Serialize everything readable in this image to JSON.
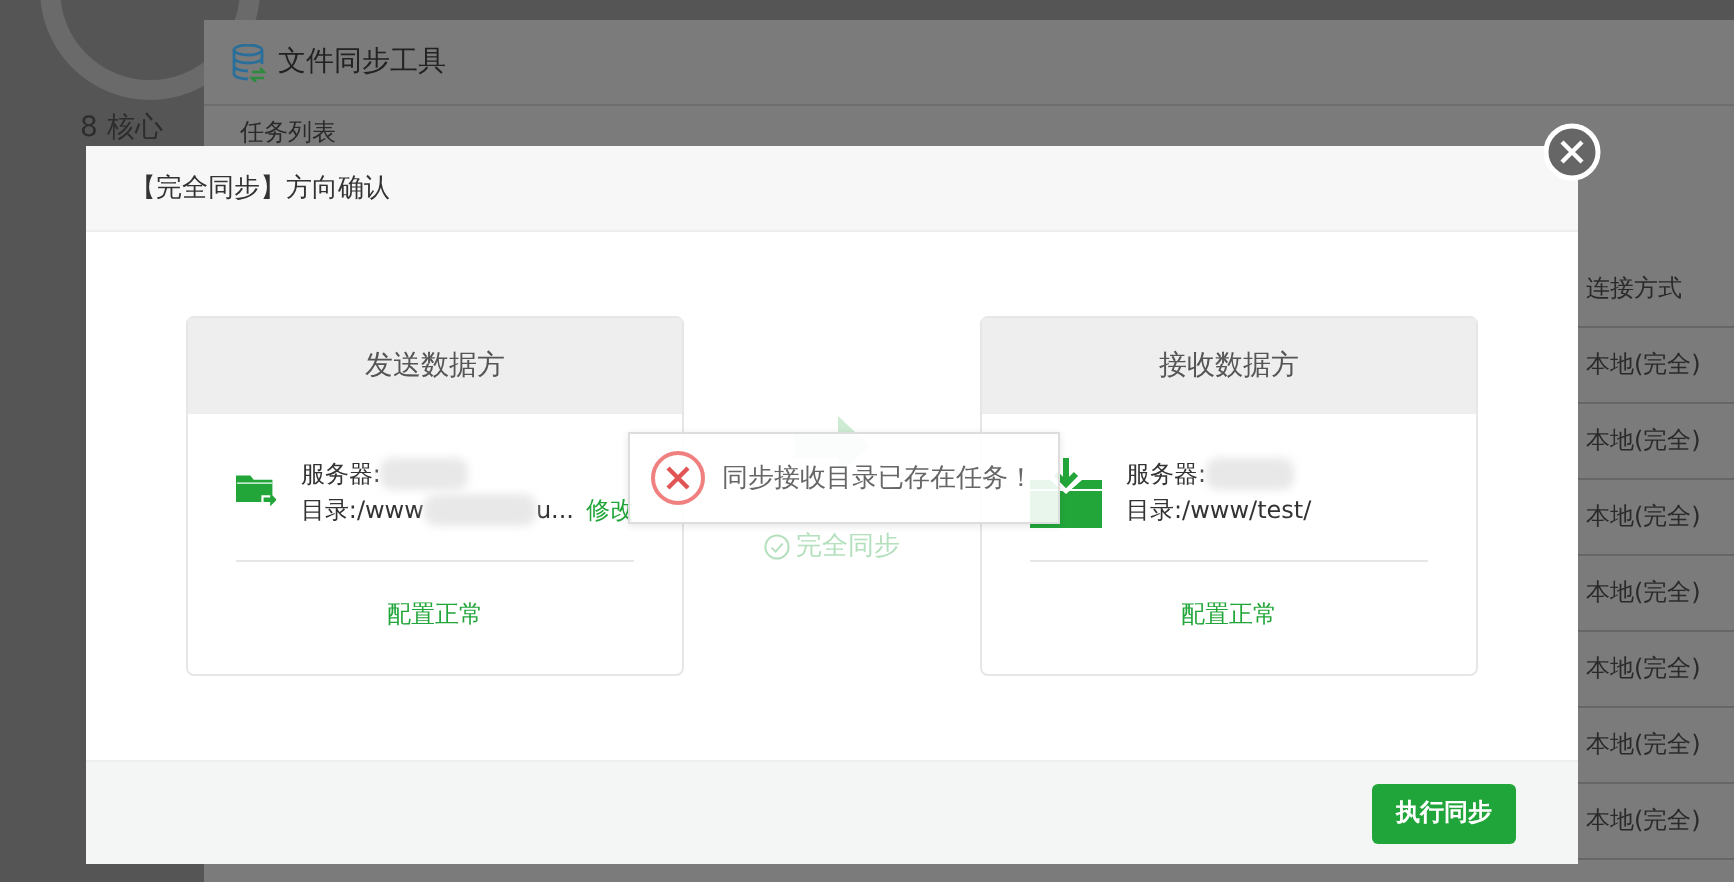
{
  "background": {
    "gauge_caption": "8 核心",
    "window": {
      "title": "文件同步工具",
      "tab": "任务列表"
    },
    "table": {
      "column": "连接方式",
      "rows": [
        "本地(完全)",
        "本地(完全)",
        "本地(完全)",
        "本地(完全)",
        "本地(完全)",
        "本地(完全)",
        "本地(完全)"
      ]
    }
  },
  "dialog": {
    "title": "【完全同步】方向确认",
    "sender": {
      "heading": "发送数据方",
      "server_label": "服务器:",
      "dir_prefix": "目录:/www",
      "dir_suffix": "u...",
      "edit_link": "修改",
      "status": "配置正常"
    },
    "mode": "完全同步",
    "receiver": {
      "heading": "接收数据方",
      "server_label": "服务器:",
      "directory": "目录:/www/test/",
      "status": "配置正常"
    },
    "button": "执行同步"
  },
  "toast": {
    "message": "同步接收目录已存在任务！"
  }
}
